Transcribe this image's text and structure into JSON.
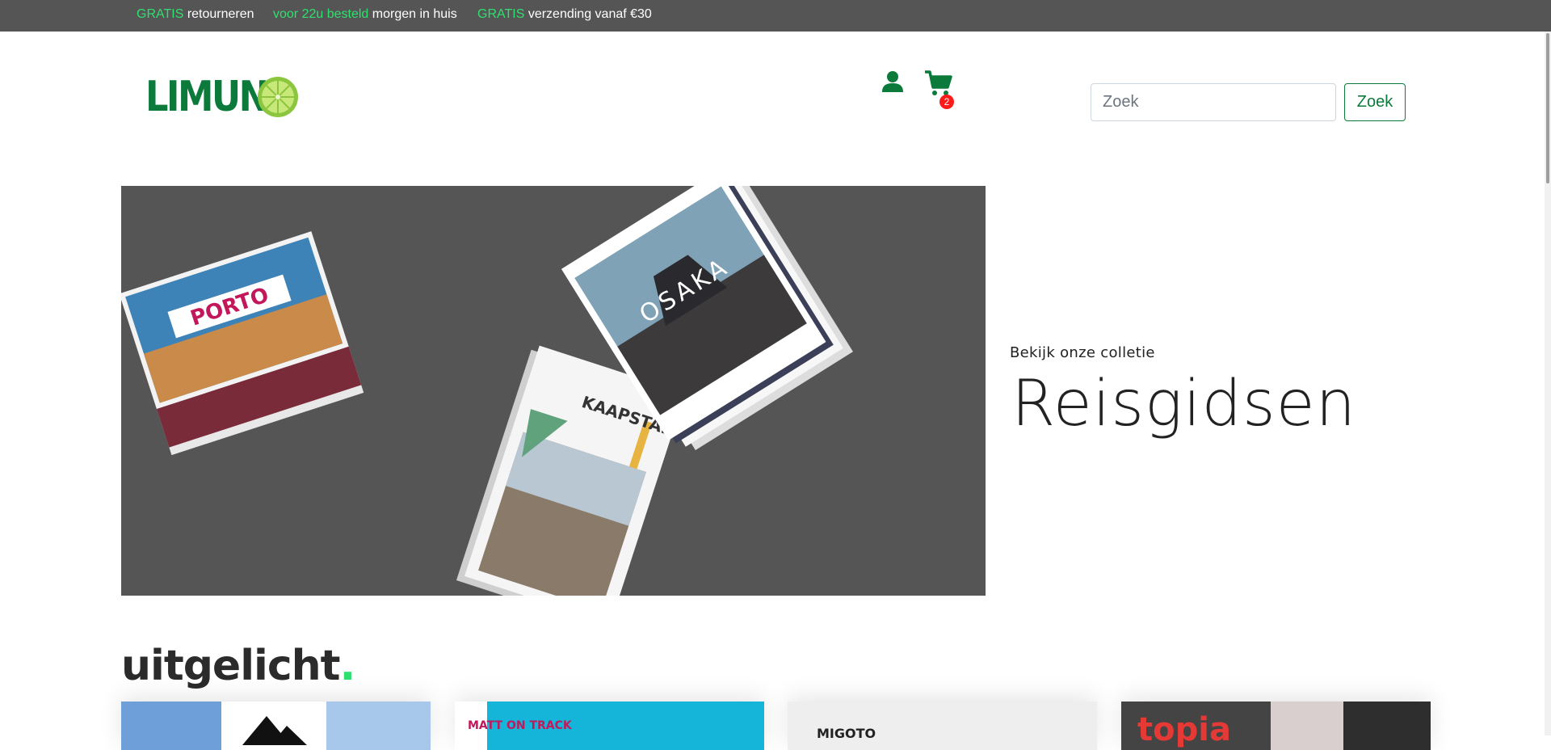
{
  "topbar": {
    "promos": [
      {
        "highlight": "GRATIS",
        "text": " retourneren"
      },
      {
        "highlight": "voor 22u besteld",
        "text": " morgen in huis"
      },
      {
        "highlight": "GRATIS",
        "text": " verzending vanaf €30"
      }
    ]
  },
  "header": {
    "logo_text": "LIMUND",
    "cart_count": "2",
    "search": {
      "placeholder": "Zoek",
      "value": "",
      "button_label": "Zoek"
    }
  },
  "hero": {
    "books": [
      "PORTO",
      "OSAKA",
      "KAAPSTAD"
    ],
    "subtitle": "Bekijk onze colletie",
    "title": "Reisgidsen"
  },
  "featured": {
    "title": "uitgelicht",
    "title_dot": ".",
    "cards": [
      {
        "label": ""
      },
      {
        "label": "MATT ON TRACK"
      },
      {
        "label": "MIGOTO"
      },
      {
        "label": "topia"
      }
    ]
  },
  "colors": {
    "brand_green": "#0b7a3b",
    "accent_green": "#2fe06f",
    "topbar_bg": "#555555",
    "hero_bg": "#555555",
    "badge_red": "#ff1a1a"
  },
  "icons": {
    "user": "user-icon",
    "cart": "cart-icon",
    "logo_mark": "lime-slice-icon"
  }
}
